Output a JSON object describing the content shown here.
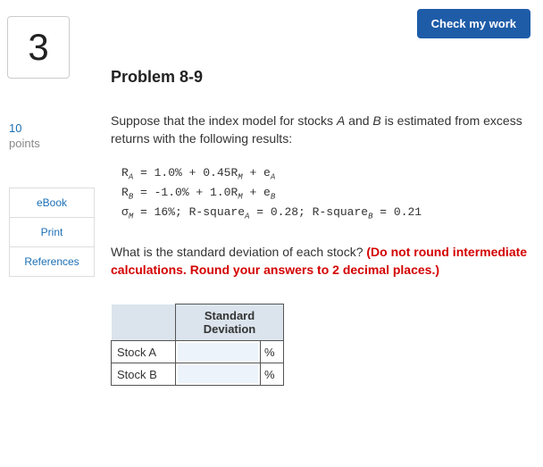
{
  "question_number": "3",
  "points_value": "10",
  "points_label": "points",
  "side_links": [
    "eBook",
    "Print",
    "References"
  ],
  "check_button": "Check my work",
  "problem_title": "Problem 8-9",
  "intro_pre": "Suppose that the index model for stocks ",
  "intro_a": "A",
  "intro_mid": " and ",
  "intro_b": "B",
  "intro_post": " is estimated from excess returns with the following results:",
  "eq": {
    "ra_lhs": "R",
    "ra_sub": "A",
    "ra_eq": " = 1.0% + 0.45",
    "ra_rm": "R",
    "ra_rmsub": "M",
    "ra_plus": " + e",
    "ra_esub": "A",
    "rb_lhs": "R",
    "rb_sub": "B",
    "rb_eq": " = -1.0% + 1.0",
    "rb_rm": "R",
    "rb_rmsub": "M",
    "rb_plus": " + e",
    "rb_esub": "B",
    "sig": "σ",
    "sig_sub": "M",
    "sig_val": " = 16%; R-square",
    "sq_a_sub": "A",
    "sq_a_val": " = 0.28; R-square",
    "sq_b_sub": "B",
    "sq_b_val": " = 0.21"
  },
  "question_text": "What is the standard deviation of each stock? ",
  "warning_text": "(Do not round intermediate calculations. Round your answers to 2 decimal places.)",
  "table_header": "Standard Deviation",
  "row_a": "Stock A",
  "row_b": "Stock B",
  "unit": "%"
}
